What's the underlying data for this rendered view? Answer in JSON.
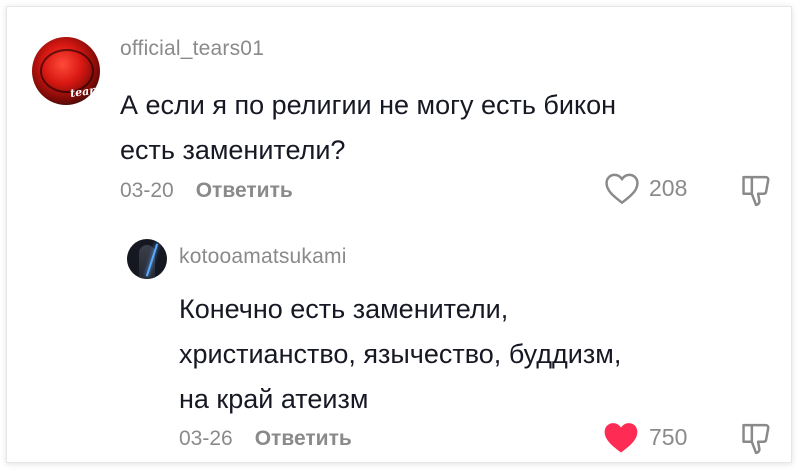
{
  "comments": [
    {
      "username": "official_tears01",
      "avatar_text": "tears",
      "text_lines": [
        "А если я по религии не могу есть бикон",
        "есть заменители?"
      ],
      "date": "03-20",
      "reply_label": "Ответить",
      "likes": "208",
      "liked": false
    },
    {
      "username": "kotooamatsukami",
      "text_lines": [
        "Конечно есть заменители,",
        "христианство, язычество, буддизм,",
        "на край атеизм"
      ],
      "date": "03-26",
      "reply_label": "Ответить",
      "likes": "750",
      "liked": true
    }
  ],
  "colors": {
    "heart_liked": "#fe2c55",
    "muted": "#8a8a8a",
    "text": "#161823"
  }
}
